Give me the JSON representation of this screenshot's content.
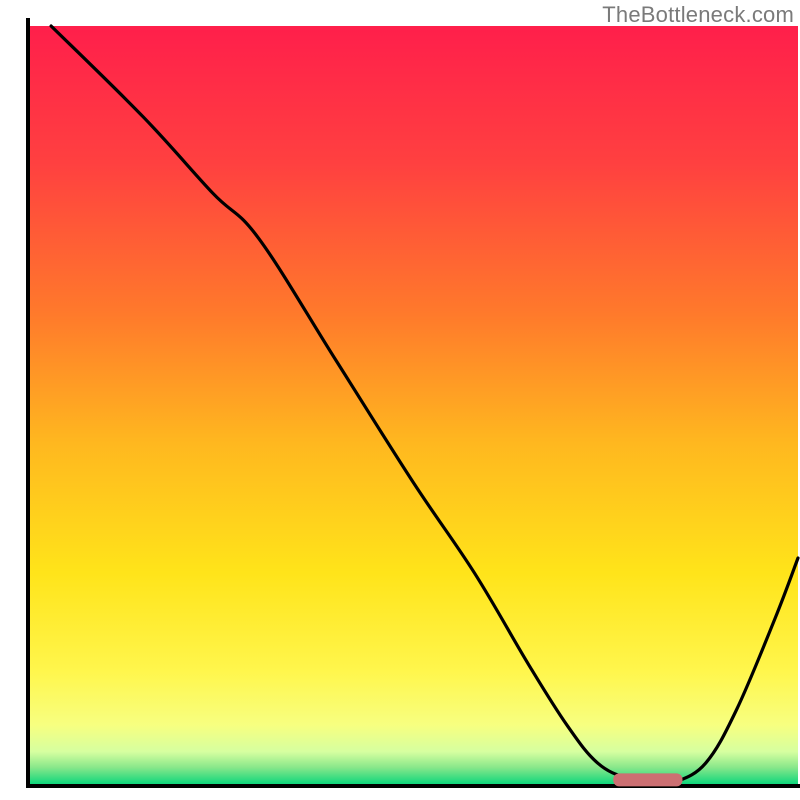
{
  "watermark": "TheBottleneck.com",
  "chart_data": {
    "type": "line",
    "title": "",
    "xlabel": "",
    "ylabel": "",
    "xlim": [
      0,
      100
    ],
    "ylim": [
      0,
      100
    ],
    "grid": false,
    "legend": false,
    "background_gradient_stops": [
      {
        "offset": 0.0,
        "color": "#ff1f4b"
      },
      {
        "offset": 0.18,
        "color": "#ff4040"
      },
      {
        "offset": 0.38,
        "color": "#ff7a2b"
      },
      {
        "offset": 0.55,
        "color": "#ffb81f"
      },
      {
        "offset": 0.72,
        "color": "#ffe41a"
      },
      {
        "offset": 0.85,
        "color": "#fff64d"
      },
      {
        "offset": 0.92,
        "color": "#f7ff80"
      },
      {
        "offset": 0.955,
        "color": "#d6ffa0"
      },
      {
        "offset": 0.975,
        "color": "#8be88b"
      },
      {
        "offset": 1.0,
        "color": "#00d47a"
      }
    ],
    "series": [
      {
        "name": "bottleneck-curve",
        "color": "#000000",
        "x": [
          3,
          15,
          24,
          30,
          40,
          50,
          58,
          65,
          70,
          74,
          78,
          82,
          84,
          88,
          92,
          97,
          100
        ],
        "y": [
          100,
          88,
          78,
          72,
          56,
          40,
          28,
          16,
          8,
          3,
          1,
          0.5,
          0.5,
          3,
          10,
          22,
          30
        ]
      }
    ],
    "marker": {
      "name": "optimal-range-marker",
      "x_start": 76,
      "x_end": 85,
      "y": 0.8,
      "color": "#cc6f72"
    },
    "axes": {
      "left": {
        "x": 3,
        "y1": 2,
        "y2": 98
      },
      "bottom": {
        "y": 98,
        "x1": 3,
        "x2": 100
      }
    }
  }
}
